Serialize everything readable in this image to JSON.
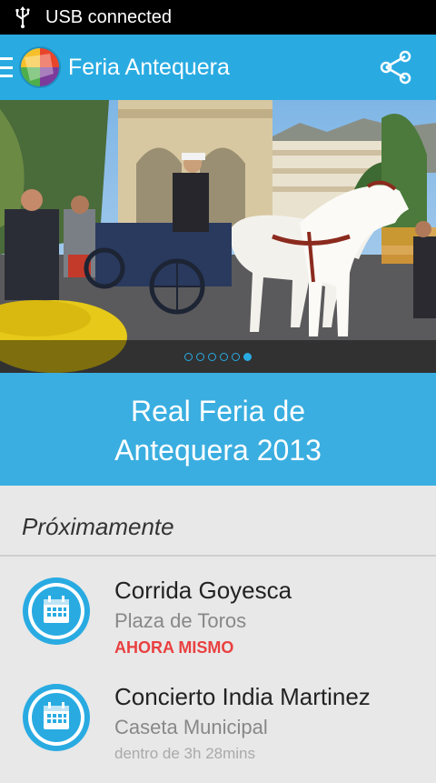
{
  "status_bar": {
    "text": "USB connected",
    "icon": "usb-icon"
  },
  "action_bar": {
    "title": "Feria Antequera",
    "menu_icon": "hamburger-icon",
    "share_icon": "share-icon",
    "color": "#29abe2"
  },
  "hero": {
    "image": "horse-carriage-photo",
    "dots": [
      false,
      false,
      false,
      false,
      false,
      true
    ]
  },
  "banner": {
    "line1": "Real Feria de",
    "line2_bold": "Antequera",
    "line2_rest": " 2013"
  },
  "upcoming": {
    "title": "Próximamente",
    "events": [
      {
        "title": "Corrida Goyesca",
        "place": "Plaza de Toros",
        "time": "AHORA MISMO",
        "icon": "calendar-icon"
      },
      {
        "title": "Concierto India Martinez",
        "place": "Caseta Municipal",
        "time": "dentro de 3h 28mins",
        "icon": "calendar-icon"
      }
    ]
  }
}
